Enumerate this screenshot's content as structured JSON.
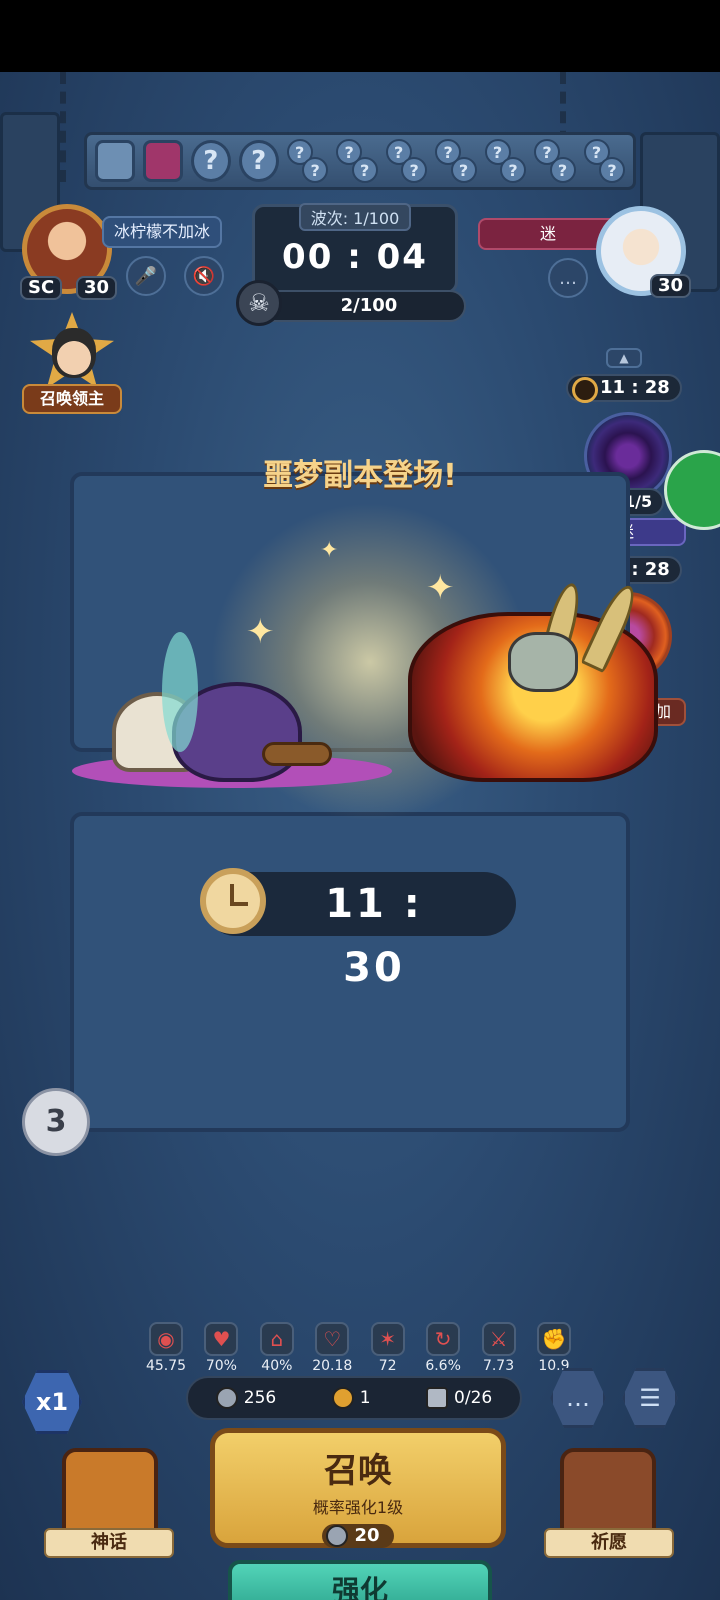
{
  "hero_slots": {
    "unknown_mark": "?"
  },
  "player": {
    "name": "冰柠檬不加冰",
    "level": "30",
    "rank_badge": "SC"
  },
  "opponent": {
    "tag": "迷",
    "level": "30"
  },
  "wave": {
    "label": "波次: 1/100",
    "timer": "00 : 04"
  },
  "kills": {
    "progress": "2/100"
  },
  "summon_lord": {
    "label": "召唤领主"
  },
  "side_events": [
    {
      "timer": "11 : 28",
      "count": "1/5",
      "tag": "迷"
    },
    {
      "timer": "11 : 28",
      "tag": "加"
    }
  ],
  "announcement": {
    "text": "噩梦副本登场!"
  },
  "boss_timer": "11 : 30",
  "bubble_count": "3",
  "stats": [
    {
      "icon": "attack-icon",
      "value": "45.75"
    },
    {
      "icon": "crit-heart-icon",
      "value": "70%"
    },
    {
      "icon": "skull-house-icon",
      "value": "40%"
    },
    {
      "icon": "broken-heart-icon",
      "value": "20.18"
    },
    {
      "icon": "shatter-icon",
      "value": "72"
    },
    {
      "icon": "spin-icon",
      "value": "6.6%"
    },
    {
      "icon": "swords-icon",
      "value": "7.73"
    },
    {
      "icon": "fist-icon",
      "value": "10.9"
    }
  ],
  "resources": {
    "silver": "256",
    "clover": "1",
    "units": "0/26"
  },
  "speed": {
    "label": "x1"
  },
  "summon": {
    "title": "召唤",
    "subtitle": "概率强化1级",
    "cost": "20"
  },
  "mythic": {
    "label": "神话"
  },
  "wish": {
    "label": "祈愿"
  },
  "upgrade": {
    "label": "强化"
  },
  "colors": {
    "accent_gold": "#f2cf6a",
    "upgrade_teal": "#52d4b8",
    "background": "#2b4a70"
  }
}
